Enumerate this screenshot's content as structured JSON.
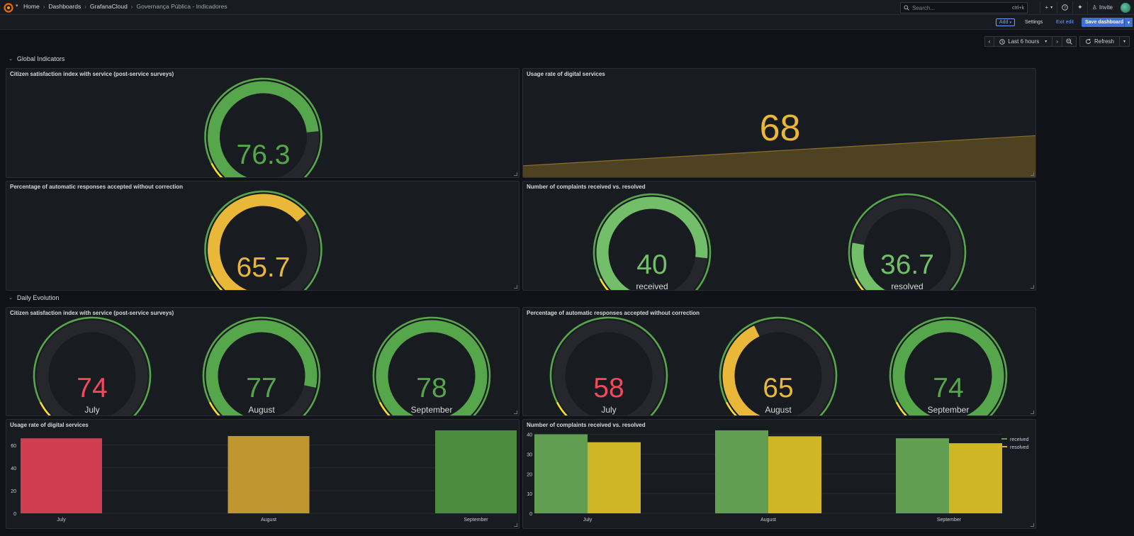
{
  "nav": {
    "breadcrumbs": [
      "Home",
      "Dashboards",
      "GrafanaCloud",
      "Governança Pública - Indicadores"
    ],
    "search_placeholder": "Search...",
    "search_shortcut": "ctrl+k",
    "plus_label": "+",
    "invite_label": "Invite"
  },
  "editbar": {
    "add_label": "Add",
    "settings_label": "Settings",
    "exit_edit_label": "Exit edit",
    "save_label": "Save dashboard"
  },
  "timepicker": {
    "range_label": "Last 6 hours",
    "refresh_label": "Refresh"
  },
  "rows": [
    {
      "title": "Global Indicators"
    },
    {
      "title": "Daily Evolution"
    }
  ],
  "colors": {
    "green": "#56a64b",
    "light_green": "#73bf69",
    "yellow": "#fade2a",
    "orange_yellow": "#eab839",
    "red": "#f2495c",
    "bar_red": "#cf3e50",
    "bar_orange": "#c0962f",
    "bar_green": "#4b8b40",
    "compl_green": "#629e51",
    "compl_yellow": "#cfb625",
    "track": "#25272d"
  },
  "panels": {
    "g_satisfaction": {
      "title": "Citizen satisfaction index with service (post-service surveys)",
      "gauges": [
        {
          "value": "76.3",
          "fraction": 0.763,
          "label": "",
          "color": "#56a64b"
        }
      ]
    },
    "g_usage": {
      "title": "Usage rate of digital services",
      "value": "68",
      "color": "#eab839"
    },
    "g_auto": {
      "title": "Percentage of automatic responses accepted without correction",
      "gauges": [
        {
          "value": "65.7",
          "fraction": 0.657,
          "label": "",
          "color": "#eab839"
        }
      ]
    },
    "g_complaints": {
      "title": "Number of complaints received vs. resolved",
      "gauges": [
        {
          "value": "40",
          "fraction": 0.8,
          "label": "received",
          "color": "#73bf69"
        },
        {
          "value": "36.7",
          "fraction": 0.25,
          "label": "resolved",
          "color": "#73bf69"
        }
      ]
    },
    "d_satisfaction": {
      "title": "Citizen satisfaction index with service (post-service surveys)",
      "gauges": [
        {
          "value": "74",
          "fraction": 0.0,
          "label": "July",
          "color": "#f2495c"
        },
        {
          "value": "77",
          "fraction": 0.82,
          "label": "August",
          "color": "#56a64b"
        },
        {
          "value": "78",
          "fraction": 1.0,
          "label": "September",
          "color": "#56a64b"
        }
      ]
    },
    "d_auto": {
      "title": "Percentage of automatic responses accepted without correction",
      "gauges": [
        {
          "value": "58",
          "fraction": 0.0,
          "label": "July",
          "color": "#f2495c"
        },
        {
          "value": "65",
          "fraction": 0.42,
          "label": "August",
          "color": "#eab839"
        },
        {
          "value": "74",
          "fraction": 1.0,
          "label": "September",
          "color": "#56a64b"
        }
      ]
    },
    "d_usage": {
      "title": "Usage rate of digital services"
    },
    "d_complaints": {
      "title": "Number of complaints received vs. resolved"
    }
  },
  "chart_data": [
    {
      "type": "area",
      "title": "Usage rate of digital services",
      "x": [
        0,
        1,
        2
      ],
      "values": [
        62,
        65,
        68
      ],
      "xlabel": "",
      "ylabel": ""
    },
    {
      "type": "bar",
      "title": "Usage rate of digital services",
      "categories": [
        "July",
        "August",
        "September"
      ],
      "values": [
        66,
        68,
        73
      ],
      "bar_colors": [
        "#cf3e50",
        "#c0962f",
        "#4b8b40"
      ],
      "yticks": [
        0,
        20,
        40,
        60
      ],
      "ylim": [
        0,
        73
      ],
      "grid": true
    },
    {
      "type": "bar",
      "title": "Number of complaints received vs. resolved",
      "categories": [
        "July",
        "August",
        "September"
      ],
      "series": [
        {
          "name": "received",
          "values": [
            40,
            42,
            38
          ],
          "color": "#629e51"
        },
        {
          "name": "resolved",
          "values": [
            36,
            39,
            35.5
          ],
          "color": "#cfb625"
        }
      ],
      "yticks": [
        0,
        10,
        20,
        30,
        40
      ],
      "ylim": [
        0,
        42
      ],
      "grid": true,
      "legend": "top-right"
    }
  ]
}
